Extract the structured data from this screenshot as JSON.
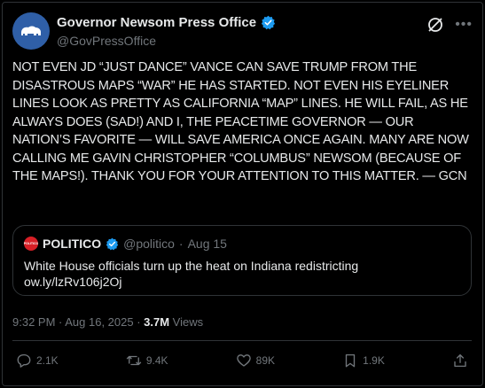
{
  "account": {
    "name": "Governor Newsom Press Office",
    "handle": "@GovPressOffice"
  },
  "post": {
    "text": "NOT EVEN JD “JUST DANCE” VANCE CAN SAVE TRUMP FROM THE DISASTROUS MAPS “WAR” HE HAS STARTED. NOT EVEN HIS EYELINER LINES LOOK AS PRETTY AS CALIFORNIA “MAP” LINES. HE WILL FAIL, AS HE ALWAYS DOES (SAD!) AND I, THE PEACETIME GOVERNOR — OUR NATION’S FAVORITE — WILL SAVE AMERICA ONCE AGAIN. MANY ARE NOW CALLING ME GAVIN CHRISTOPHER “COLUMBUS” NEWSOM (BECAUSE OF THE MAPS!). THANK YOU FOR YOUR ATTENTION TO THIS MATTER. — GCN",
    "timestamp": "9:32 PM · Aug 16, 2025 · ",
    "views_count": "3.7M",
    "views_label": " Views"
  },
  "quoted": {
    "logo_text": "POLITICO",
    "name": "POLITICO",
    "handle": "@politico",
    "separator": " · ",
    "date": "Aug 15",
    "text": "White House officials turn up the heat on Indiana redistricting",
    "link": "ow.ly/lzRv106j2Oj"
  },
  "actions": {
    "replies": "2.1K",
    "reposts": "9.4K",
    "likes": "89K",
    "bookmarks": "1.9K"
  },
  "icons": [
    "verified-badge-icon",
    "grok-icon",
    "more-icon",
    "reply-icon",
    "repost-icon",
    "like-icon",
    "bookmark-icon",
    "share-icon"
  ],
  "colors": {
    "background": "#000000",
    "text": "#e7e9ea",
    "secondary": "#71767b",
    "verified": "#1d9bf0",
    "border": "#2f3336",
    "avatar": "#2f5fa7",
    "politico_red": "#d81f26"
  }
}
